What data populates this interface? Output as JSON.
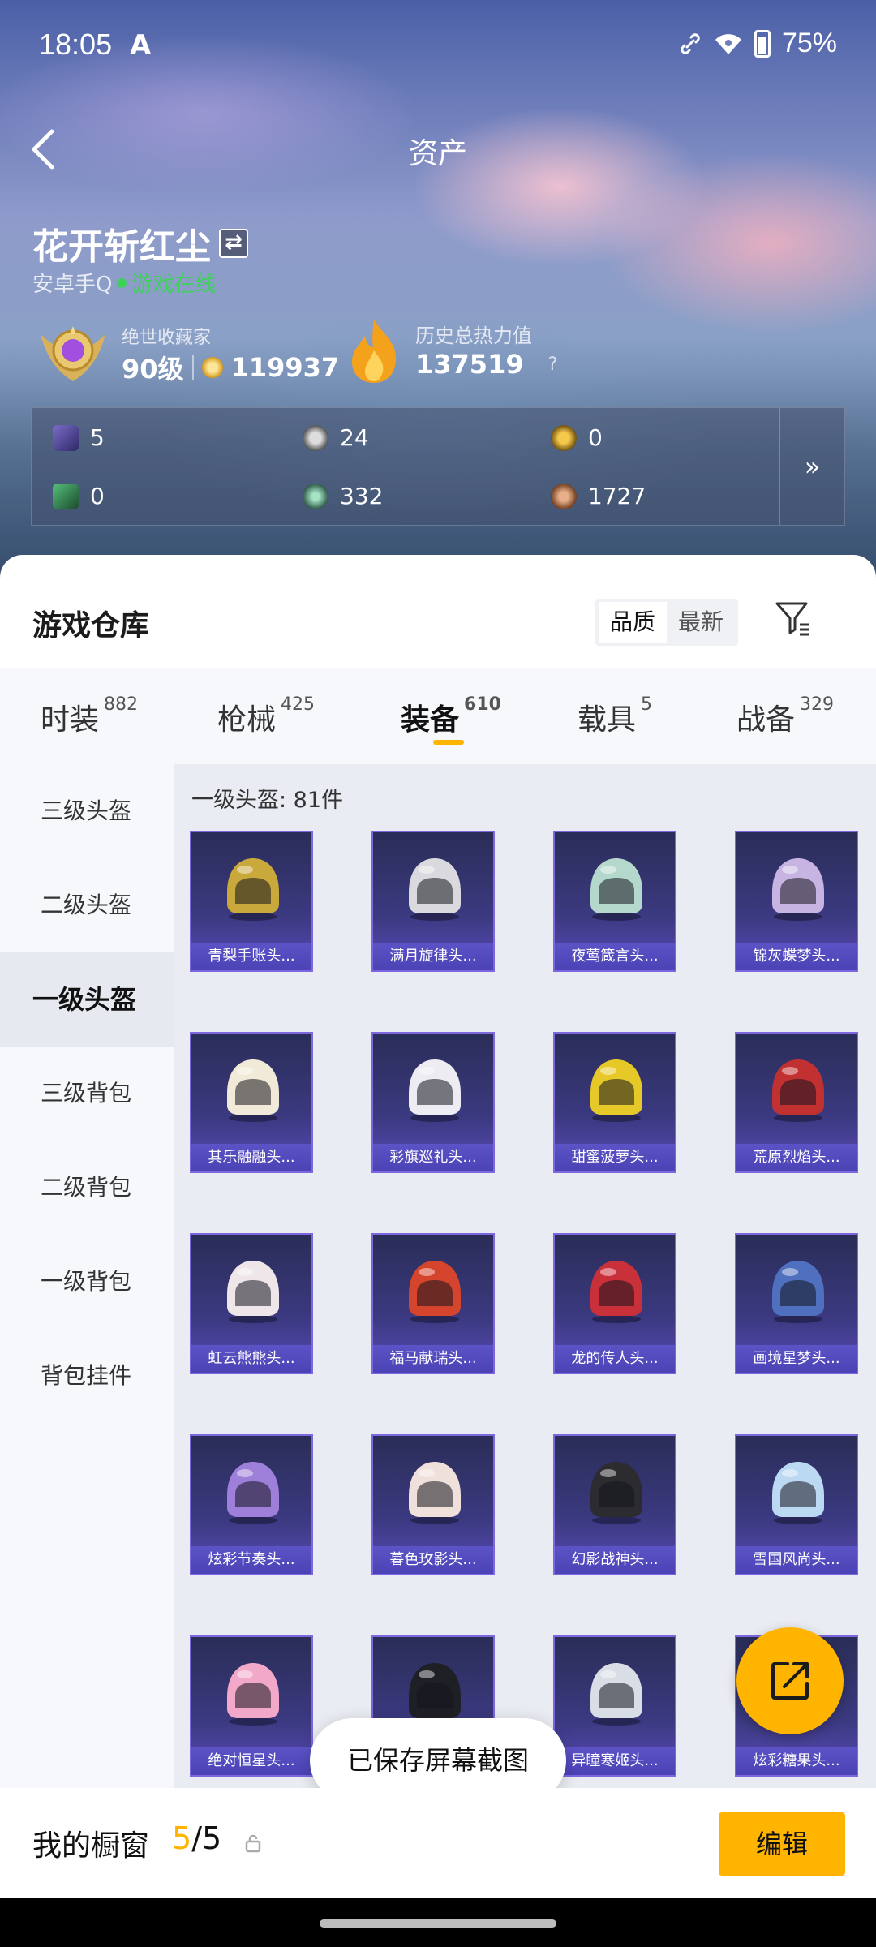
{
  "status_bar": {
    "time": "18:05",
    "battery": "75%"
  },
  "header": {
    "title": "资产"
  },
  "profile": {
    "name": "花开斩红尘",
    "platform": "安卓手Q",
    "online_status": "游戏在线",
    "rank_title": "绝世收藏家",
    "level": "90级",
    "coins": "119937",
    "heat_title": "历史总热力值",
    "heat_value": "137519",
    "heat_help": "?"
  },
  "resources": [
    {
      "icon": "purple-card-icon",
      "value": "5"
    },
    {
      "icon": "silver-medal-icon",
      "value": "24"
    },
    {
      "icon": "gold-medal-icon",
      "value": "0"
    },
    {
      "icon": "green-card-icon",
      "value": "0"
    },
    {
      "icon": "green-orb-icon",
      "value": "332"
    },
    {
      "icon": "bronze-token-icon",
      "value": "1727"
    }
  ],
  "resources_more": "»",
  "warehouse": {
    "title": "游戏仓库",
    "sort_options": [
      "品质",
      "最新"
    ],
    "sort_selected": "品质"
  },
  "tabs": [
    {
      "label": "时装",
      "count": "882"
    },
    {
      "label": "枪械",
      "count": "425"
    },
    {
      "label": "装备",
      "count": "610"
    },
    {
      "label": "载具",
      "count": "5"
    },
    {
      "label": "战备",
      "count": "329"
    }
  ],
  "active_tab": "装备",
  "sidebar": [
    "三级头盔",
    "二级头盔",
    "一级头盔",
    "三级背包",
    "二级背包",
    "一级背包",
    "背包挂件"
  ],
  "sidebar_active": "一级头盔",
  "grid": {
    "count_label": "一级头盔: 81件",
    "items": [
      {
        "name": "青梨手账头...",
        "color": "#c9a83c"
      },
      {
        "name": "满月旋律头...",
        "color": "#d9d9de"
      },
      {
        "name": "夜莺箴言头...",
        "color": "#b5d8cc"
      },
      {
        "name": "锦灰蝶梦头...",
        "color": "#c8b4e2"
      },
      {
        "name": "其乐融融头...",
        "color": "#f1ead8"
      },
      {
        "name": "彩旗巡礼头...",
        "color": "#ececf2"
      },
      {
        "name": "甜蜜菠萝头...",
        "color": "#e6c928"
      },
      {
        "name": "荒原烈焰头...",
        "color": "#c23131"
      },
      {
        "name": "虹云熊熊头...",
        "color": "#efe6ea"
      },
      {
        "name": "福马献瑞头...",
        "color": "#d5452d"
      },
      {
        "name": "龙的传人头...",
        "color": "#c8303a"
      },
      {
        "name": "画境星梦头...",
        "color": "#4f6fbf"
      },
      {
        "name": "炫彩节奏头...",
        "color": "#9e7fd9"
      },
      {
        "name": "暮色玫影头...",
        "color": "#f0e0dc"
      },
      {
        "name": "幻影战神头...",
        "color": "#2b2b30"
      },
      {
        "name": "雪国风尚头...",
        "color": "#bcd9f3"
      },
      {
        "name": "绝对恒星头...",
        "color": "#f2a8c8"
      },
      {
        "name": "",
        "color": "#1f1f26"
      },
      {
        "name": "异瞳寒姬头...",
        "color": "#d8dde6"
      },
      {
        "name": "炫彩糖果头...",
        "color": "#f0c2d8"
      }
    ]
  },
  "toast": "已保存屏幕截图",
  "showcase": {
    "label": "我的橱窗",
    "current": "5",
    "total": "5",
    "edit_label": "编辑"
  }
}
